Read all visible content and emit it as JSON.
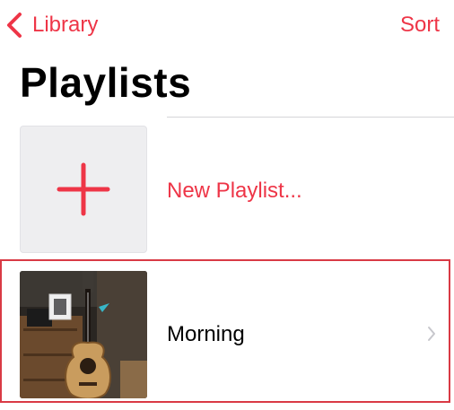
{
  "nav": {
    "back_label": "Library",
    "back_icon": "chevron-left-icon",
    "sort_label": "Sort"
  },
  "page": {
    "title": "Playlists"
  },
  "new_playlist": {
    "label": "New Playlist...",
    "icon": "plus-icon"
  },
  "playlists": [
    {
      "title": "Morning",
      "artwork": "guitar-photo"
    }
  ],
  "colors": {
    "accent": "#ee3547",
    "selection_border": "#d93a45",
    "tile_background": "#eeeef0",
    "divider": "#d6d6d8"
  }
}
